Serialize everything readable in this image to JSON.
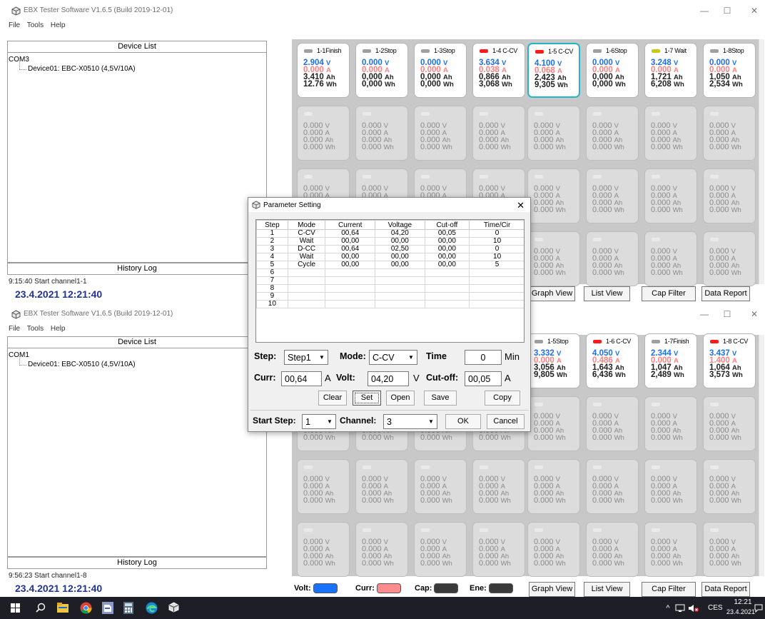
{
  "window1": {
    "title": "EBX Tester Software V1.6.5 (Build 2019-12-01)",
    "menu": [
      "File",
      "Tools",
      "Help"
    ],
    "device_list_label": "Device List",
    "com_port": "COM3",
    "device": "Device01: EBC-X0510 (4,5V/10A)",
    "history_label": "History Log",
    "log_line": "9:15:40 Start channel1-1",
    "clock": "23.4.2021  12:21:40"
  },
  "window2": {
    "title": "EBX Tester Software V1.6.5 (Build 2019-12-01)",
    "menu": [
      "File",
      "Tools",
      "Help"
    ],
    "device_list_label": "Device List",
    "com_port": "COM1",
    "device": "Device01: EBC-X0510 (4,5V/10A)",
    "history_label": "History Log",
    "log_line": "9:56:23 Start channel1-8",
    "clock": "23.4.2021  12:21:40"
  },
  "units": {
    "v": "V",
    "a": "A",
    "ah": "Ah",
    "wh": "Wh"
  },
  "idle_cell": {
    "v": "0.000",
    "a": "0.000",
    "ah": "0.000",
    "wh": "0.000"
  },
  "top_channels1": [
    {
      "label": "1-1Finish",
      "led": "#9f9f9f",
      "v": "2.904",
      "a": "0.000",
      "ah": "3.410",
      "wh": "12.76"
    },
    {
      "label": "1-2Stop",
      "led": "#9f9f9f",
      "v": "0.000",
      "a": "0.000",
      "ah": "0,000",
      "wh": "0,000"
    },
    {
      "label": "1-3Stop",
      "led": "#9f9f9f",
      "v": "0.000",
      "a": "0.000",
      "ah": "0,000",
      "wh": "0,000"
    },
    {
      "label": "1-4 C-CV",
      "led": "#ff1a1a",
      "v": "3.634",
      "a": "0.038",
      "ah": "0,866",
      "wh": "3,068"
    },
    {
      "label": "1-5 C-CV",
      "led": "#ff1a1a",
      "v": "4.100",
      "a": "0.068",
      "ah": "2,423",
      "wh": "9,305"
    },
    {
      "label": "1-6Stop",
      "led": "#9f9f9f",
      "v": "0.000",
      "a": "0.000",
      "ah": "0,000",
      "wh": "0,000"
    },
    {
      "label": "1-7 Wait",
      "led": "#c8c81a",
      "v": "3.248",
      "a": "0.000",
      "ah": "1,721",
      "wh": "6,208"
    },
    {
      "label": "1-8Stop",
      "led": "#9f9f9f",
      "v": "0.000",
      "a": "0.000",
      "ah": "1,050",
      "wh": "2,534"
    }
  ],
  "top_channels2": [
    {
      "label": "1-5Stop",
      "led": "#9f9f9f",
      "v": "3.332",
      "a": "0.000",
      "ah": "3,056",
      "wh": "9,805"
    },
    {
      "label": "1-6 C-CV",
      "led": "#ff1a1a",
      "v": "4.050",
      "a": "0.486",
      "ah": "1,643",
      "wh": "6,436"
    },
    {
      "label": "1-7Finish",
      "led": "#9f9f9f",
      "v": "2.344",
      "a": "0.000",
      "ah": "1,047",
      "wh": "2,489"
    },
    {
      "label": "1-8 C-CV",
      "led": "#ff1a1a",
      "v": "3.437",
      "a": "1.400",
      "ah": "1,064",
      "wh": "3,573"
    }
  ],
  "buttons": {
    "graph": "Graph View",
    "list": "List View",
    "cap": "Cap Filter",
    "report": "Data Report"
  },
  "legend": {
    "volt": "Volt:",
    "curr": "Curr:",
    "cap": "Cap:",
    "ene": "Ene:",
    "volt_color": "#1a73ff",
    "curr_color": "#ff8c8c",
    "cap_color": "#3a3a3a",
    "ene_color": "#3a3a3a"
  },
  "dialog": {
    "title": "Parameter Setting",
    "columns": [
      "Step",
      "Mode",
      "Current",
      "Voltage",
      "Cut-off",
      "Time/Cir"
    ],
    "rows": [
      [
        "1",
        "C-CV",
        "00,64",
        "04,20",
        "00,05",
        "0"
      ],
      [
        "2",
        "Wait",
        "00,00",
        "00,00",
        "00,00",
        "10"
      ],
      [
        "3",
        "D-CC",
        "00,64",
        "02,50",
        "00,00",
        "0"
      ],
      [
        "4",
        "Wait",
        "00,00",
        "00,00",
        "00,00",
        "10"
      ],
      [
        "5",
        "Cycle",
        "00,00",
        "00,00",
        "00,00",
        "5"
      ],
      [
        "6",
        "",
        "",
        "",
        "",
        ""
      ],
      [
        "7",
        "",
        "",
        "",
        "",
        ""
      ],
      [
        "8",
        "",
        "",
        "",
        "",
        ""
      ],
      [
        "9",
        "",
        "",
        "",
        "",
        ""
      ],
      [
        "10",
        "",
        "",
        "",
        "",
        ""
      ]
    ],
    "step_label": "Step:",
    "step_value": "Step1",
    "mode_label": "Mode:",
    "mode_value": "C-CV",
    "time_label": "Time",
    "time_value": "0",
    "time_unit": "Min",
    "curr_label": "Curr:",
    "curr_value": "00,64",
    "curr_unit": "A",
    "volt_label": "Volt:",
    "volt_value": "04,20",
    "volt_unit": "V",
    "cutoff_label": "Cut-off:",
    "cutoff_value": "00,05",
    "cutoff_unit": "A",
    "btn_clear": "Clear",
    "btn_set": "Set",
    "btn_open": "Open",
    "btn_save": "Save",
    "btn_copy": "Copy",
    "start_label": "Start Step:",
    "start_value": "1",
    "channel_label": "Channel:",
    "channel_value": "3",
    "btn_ok": "OK",
    "btn_cancel": "Cancel"
  },
  "taskbar": {
    "time": "12:21",
    "date": "23.4.2021",
    "lang": "CES"
  }
}
